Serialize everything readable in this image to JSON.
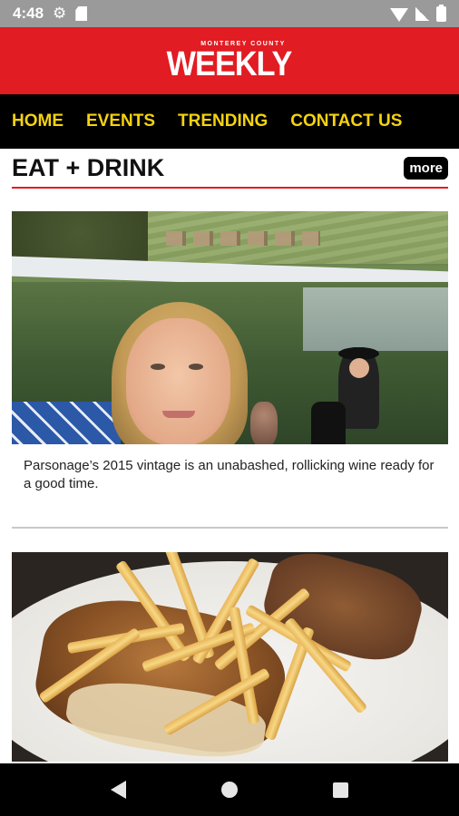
{
  "status_bar": {
    "time": "4:48"
  },
  "header": {
    "logo_small": "MONTEREY COUNTY",
    "logo_big": "WEEKLY"
  },
  "nav": {
    "items": [
      {
        "label": "HOME"
      },
      {
        "label": "EVENTS"
      },
      {
        "label": "TRENDING"
      },
      {
        "label": "CONTACT US"
      }
    ]
  },
  "section": {
    "title": "EAT + DRINK",
    "more_label": "more"
  },
  "articles": [
    {
      "caption": "Parsonage’s 2015 vintage is an unabashed, rollicking wine ready for a good time."
    }
  ],
  "colors": {
    "brand_red": "#e11c22",
    "nav_yellow": "#f5d20f",
    "nav_bg": "#000000"
  }
}
